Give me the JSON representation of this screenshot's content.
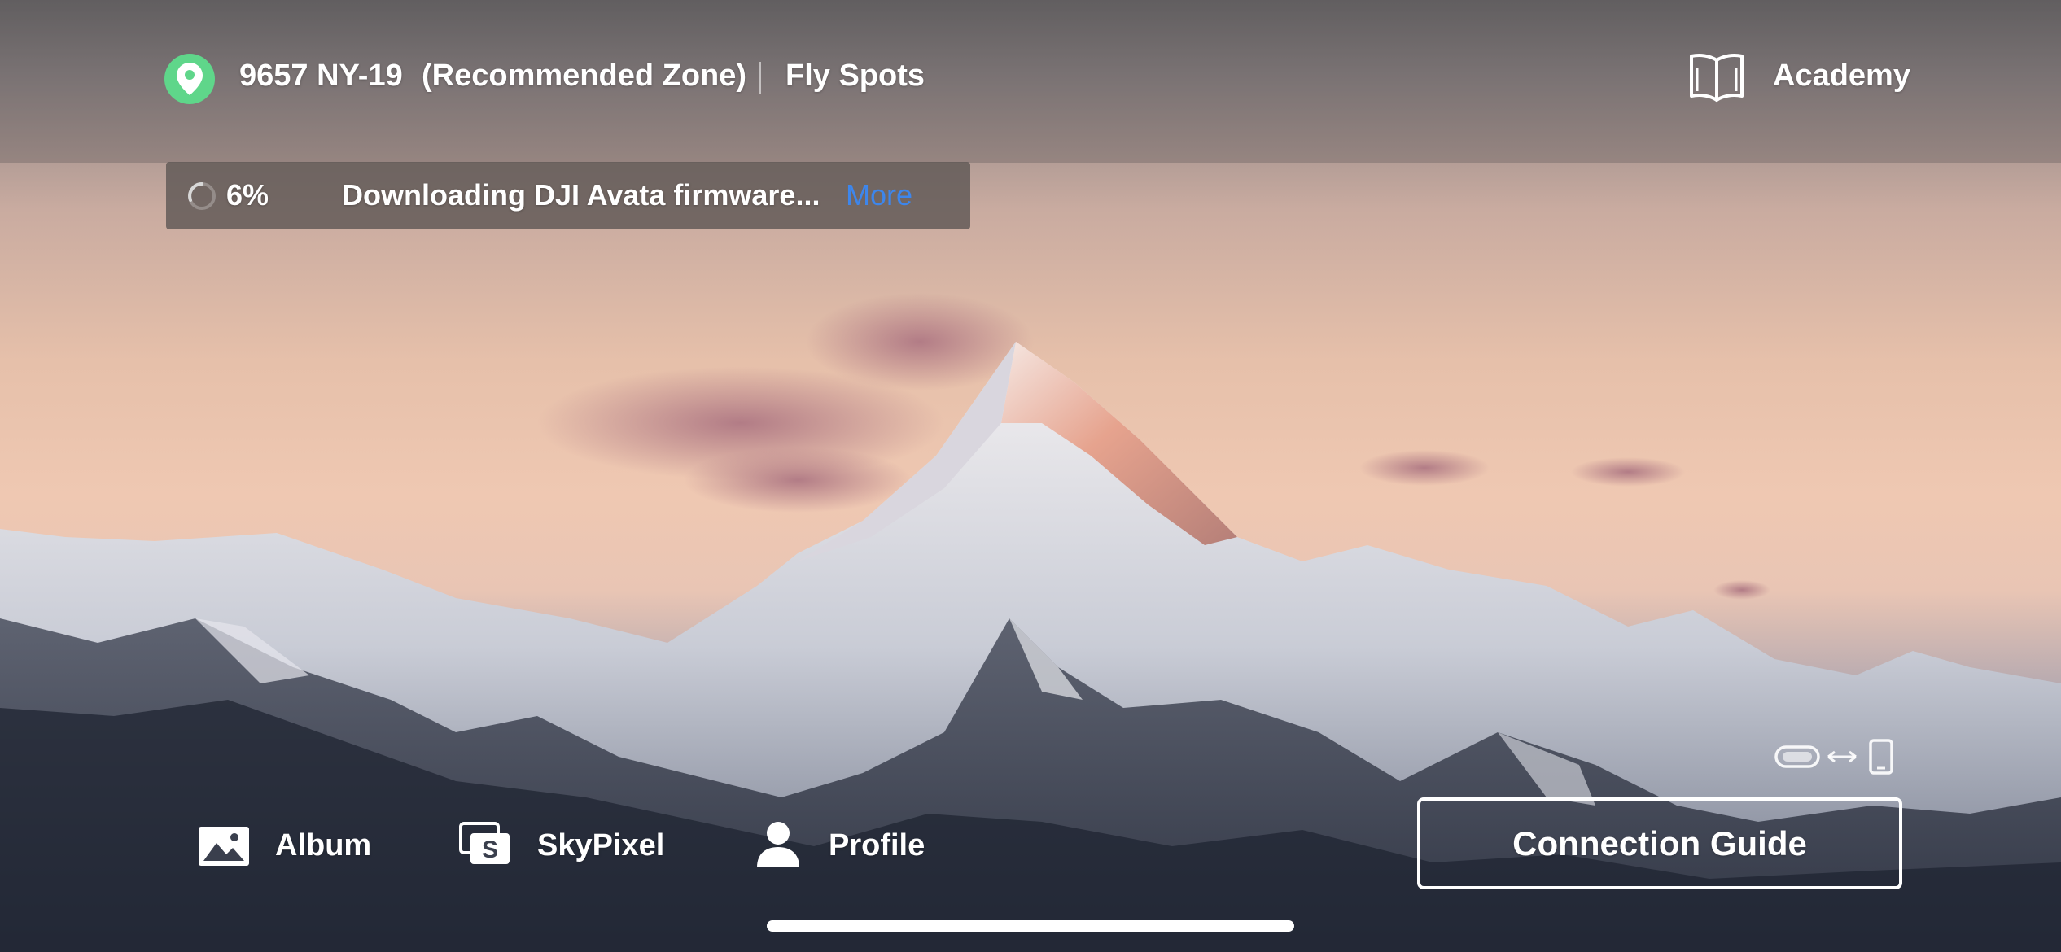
{
  "top_bar": {
    "location_address": "9657 NY-19",
    "zone_label": "(Recommended Zone)",
    "fly_spots_label": "Fly Spots",
    "academy_label": "Academy"
  },
  "download": {
    "percent_text": "6%",
    "progress_fraction": 0.06,
    "message": "Downloading DJI Avata firmware...",
    "more_label": "More"
  },
  "bottom_nav": {
    "album_label": "Album",
    "skypixel_label": "SkyPixel",
    "profile_label": "Profile"
  },
  "connection_guide_label": "Connection Guide",
  "icons": {
    "location": "location-pin-icon",
    "academy": "book-icon",
    "spinner": "loading-spinner-icon",
    "album": "image-icon",
    "skypixel": "skypixel-icon",
    "profile": "person-icon",
    "goggles": "goggles-icon",
    "link": "double-arrow-icon",
    "phone": "phone-icon"
  },
  "colors": {
    "location_pin": "#5fd68a",
    "more_link": "#3d86ec",
    "text": "#ffffff"
  }
}
